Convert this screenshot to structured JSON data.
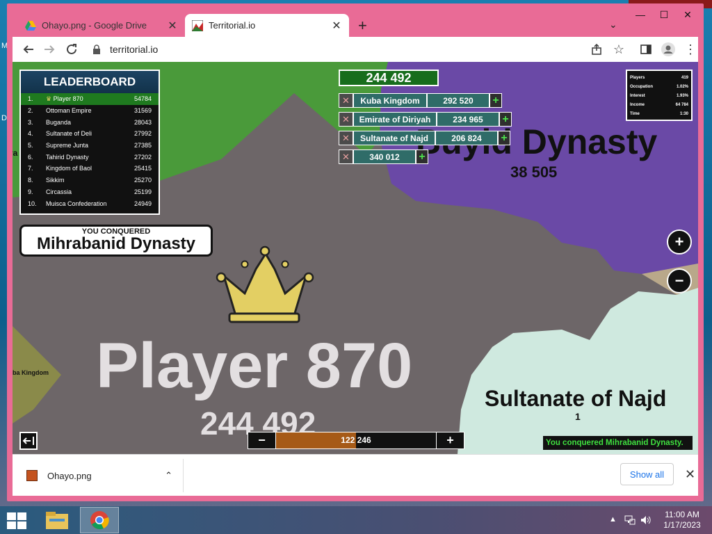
{
  "desktop": {
    "left_text_1": "M",
    "left_text_2": "D"
  },
  "browser": {
    "tabs": [
      {
        "title": "Ohayo.png - Google Drive",
        "close": "✕"
      },
      {
        "title": "Territorial.io",
        "close": "✕"
      }
    ],
    "new_tab": "+",
    "tab_dropdown": "⌄",
    "window_controls": {
      "minimize": "—",
      "maximize": "☐",
      "close": "✕"
    },
    "url": "territorial.io",
    "icons": {
      "back": "arrow-left",
      "forward": "arrow-right",
      "reload": "reload",
      "lock": "lock",
      "share": "share",
      "star": "star",
      "sidepanel": "side-panel",
      "profile": "profile",
      "menu": "kebab-menu"
    }
  },
  "game": {
    "leaderboard": {
      "title": "LEADERBOARD",
      "rows": [
        {
          "rank": "1.",
          "name": "Player 870",
          "score": "54784"
        },
        {
          "rank": "2.",
          "name": "Ottoman Empire",
          "score": "31569"
        },
        {
          "rank": "3.",
          "name": "Buganda",
          "score": "28043"
        },
        {
          "rank": "4.",
          "name": "Sultanate of Deli",
          "score": "27992"
        },
        {
          "rank": "5.",
          "name": "Supreme Junta",
          "score": "27385"
        },
        {
          "rank": "6.",
          "name": "Tahirid Dynasty",
          "score": "27202"
        },
        {
          "rank": "7.",
          "name": "Kingdom of Baol",
          "score": "25415"
        },
        {
          "rank": "8.",
          "name": "Sikkim",
          "score": "25270"
        },
        {
          "rank": "9.",
          "name": "Circassia",
          "score": "25199"
        },
        {
          "rank": "10.",
          "name": "Muisca Confederation",
          "score": "24949"
        }
      ]
    },
    "conquered": {
      "label": "YOU CONQUERED",
      "name": "Mihrabanid Dynasty"
    },
    "balance": "244 492",
    "attacks": [
      {
        "name": "Kuba Kingdom",
        "value": "292 520",
        "remove": "✕",
        "add": "+"
      },
      {
        "name": "Emirate of Diriyah",
        "value": "234 965",
        "remove": "✕",
        "add": "+"
      },
      {
        "name": "Sultanate of Najd",
        "value": "206 824",
        "remove": "✕",
        "add": "+"
      },
      {
        "name": "",
        "value": "340 012",
        "remove": "✕",
        "add": "+"
      }
    ],
    "stats": [
      {
        "label": "Players",
        "value": "419"
      },
      {
        "label": "Occupation",
        "value": "1.02%"
      },
      {
        "label": "Interest",
        "value": "1.93%"
      },
      {
        "label": "Income",
        "value": "64 784"
      },
      {
        "label": "Time",
        "value": "1:30"
      }
    ],
    "zoom_in": "+",
    "zoom_out": "−",
    "map_labels": {
      "buyid_name": "Buyid Dynasty",
      "buyid_value": "38 505",
      "najd_name": "Sultanate of Najd",
      "najd_value": "1",
      "player_name": "Player 870",
      "player_value": "244 492",
      "kuba_partial": "ba Kingdom",
      "left_partial": "ra"
    },
    "slider": {
      "minus": "−",
      "plus": "+",
      "value": "122 246",
      "fraction": 0.5
    },
    "exit_icon": "exit-icon",
    "message": "You conquered Mihrabanid Dynasty.",
    "colors": {
      "player": "#6d6668",
      "buyid": "#6a49a6",
      "najd": "#cfe9df",
      "green_territory": "#4a9a3a",
      "kuba": "#8a8a4a"
    }
  },
  "downloads": {
    "file": "Ohayo.png",
    "chevron": "⌃",
    "show_all": "Show all",
    "close": "✕"
  },
  "taskbar": {
    "time": "11:00 AM",
    "date": "1/17/2023",
    "tray_arrow": "▲"
  }
}
